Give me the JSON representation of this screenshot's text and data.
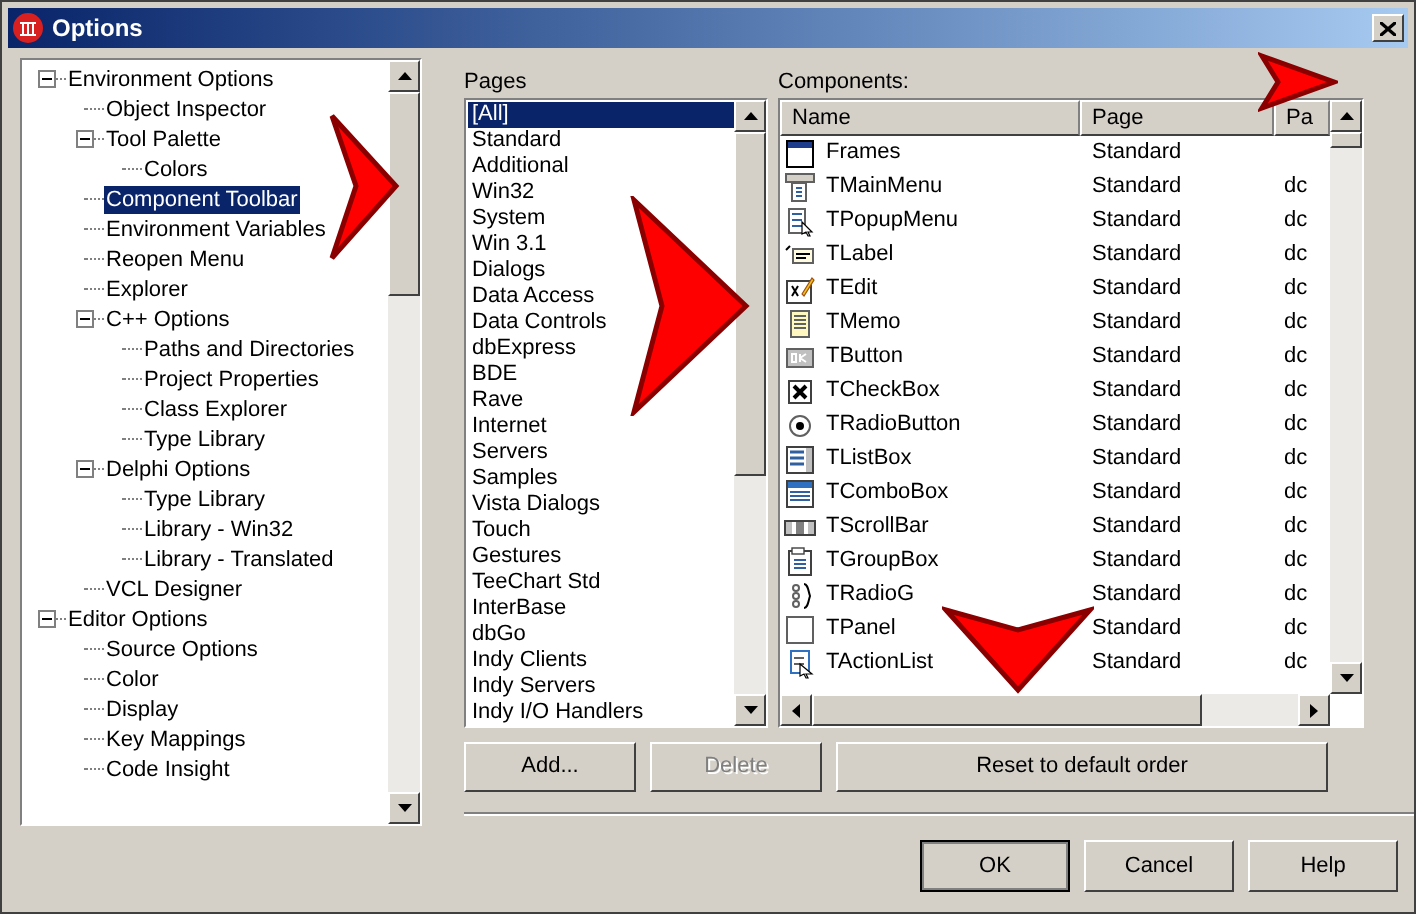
{
  "window": {
    "title": "Options"
  },
  "tree": [
    {
      "label": "Environment Options",
      "expanded": true,
      "selected": false,
      "children": [
        {
          "label": "Object Inspector",
          "selected": false
        },
        {
          "label": "Tool Palette",
          "expanded": true,
          "selected": false,
          "children": [
            {
              "label": "Colors",
              "selected": false
            }
          ]
        },
        {
          "label": "Component Toolbar",
          "selected": true
        },
        {
          "label": "Environment Variables",
          "selected": false
        },
        {
          "label": "Reopen Menu",
          "selected": false
        },
        {
          "label": "Explorer",
          "selected": false
        },
        {
          "label": "C++ Options",
          "expanded": true,
          "selected": false,
          "children": [
            {
              "label": "Paths and Directories",
              "selected": false
            },
            {
              "label": "Project Properties",
              "selected": false
            },
            {
              "label": "Class Explorer",
              "selected": false
            },
            {
              "label": "Type Library",
              "selected": false
            }
          ]
        },
        {
          "label": "Delphi Options",
          "expanded": true,
          "selected": false,
          "children": [
            {
              "label": "Type Library",
              "selected": false
            },
            {
              "label": "Library - Win32",
              "selected": false
            },
            {
              "label": "Library - Translated",
              "selected": false
            }
          ]
        },
        {
          "label": "VCL Designer",
          "selected": false
        }
      ]
    },
    {
      "label": "Editor Options",
      "expanded": true,
      "selected": false,
      "children": [
        {
          "label": "Source Options",
          "selected": false
        },
        {
          "label": "Color",
          "selected": false
        },
        {
          "label": "Display",
          "selected": false
        },
        {
          "label": "Key Mappings",
          "selected": false
        },
        {
          "label": "Code Insight",
          "selected": false
        }
      ]
    }
  ],
  "pages": {
    "label": "Pages",
    "items": [
      {
        "label": "[All]",
        "selected": true
      },
      {
        "label": "Standard",
        "selected": false
      },
      {
        "label": "Additional",
        "selected": false
      },
      {
        "label": "Win32",
        "selected": false
      },
      {
        "label": "System",
        "selected": false
      },
      {
        "label": "Win 3.1",
        "selected": false
      },
      {
        "label": "Dialogs",
        "selected": false
      },
      {
        "label": "Data Access",
        "selected": false
      },
      {
        "label": "Data Controls",
        "selected": false
      },
      {
        "label": "dbExpress",
        "selected": false
      },
      {
        "label": "BDE",
        "selected": false
      },
      {
        "label": "Rave",
        "selected": false
      },
      {
        "label": "Internet",
        "selected": false
      },
      {
        "label": "Servers",
        "selected": false
      },
      {
        "label": "Samples",
        "selected": false
      },
      {
        "label": "Vista Dialogs",
        "selected": false
      },
      {
        "label": "Touch",
        "selected": false
      },
      {
        "label": "Gestures",
        "selected": false
      },
      {
        "label": "TeeChart Std",
        "selected": false
      },
      {
        "label": "InterBase",
        "selected": false
      },
      {
        "label": "dbGo",
        "selected": false
      },
      {
        "label": "Indy Clients",
        "selected": false
      },
      {
        "label": "Indy Servers",
        "selected": false
      },
      {
        "label": "Indy I/O Handlers",
        "selected": false
      }
    ]
  },
  "components": {
    "label": "Components:",
    "columns": [
      "Name",
      "Page",
      "Pa"
    ],
    "rows": [
      {
        "name": "Frames",
        "page": "Standard"
      },
      {
        "name": "TMainMenu",
        "page": "Standard",
        "column_3": "dc"
      },
      {
        "name": "TPopupMenu",
        "page": "Standard",
        "column_3": "dc"
      },
      {
        "name": "TLabel",
        "page": "Standard",
        "column_3": "dc"
      },
      {
        "name": "TEdit",
        "page": "Standard",
        "column_3": "dc"
      },
      {
        "name": "TMemo",
        "page": "Standard",
        "column_3": "dc"
      },
      {
        "name": "TButton",
        "page": "Standard",
        "column_3": "dc"
      },
      {
        "name": "TCheckBox",
        "page": "Standard",
        "column_3": "dc"
      },
      {
        "name": "TRadioButton",
        "page": "Standard",
        "column_3": "dc"
      },
      {
        "name": "TListBox",
        "page": "Standard",
        "column_3": "dc"
      },
      {
        "name": "TComboBox",
        "page": "Standard",
        "column_3": "dc"
      },
      {
        "name": "TScrollBar",
        "page": "Standard",
        "column_3": "dc"
      },
      {
        "name": "TGroupBox",
        "page": "Standard",
        "column_3": "dc"
      },
      {
        "name": "TRadioG",
        "page": "Standard",
        "column_3": "dc"
      },
      {
        "name": "TPanel",
        "page": "Standard",
        "column_3": "dc"
      },
      {
        "name": "TActionList",
        "page": "Standard",
        "column_3": "dc"
      }
    ]
  },
  "list_buttons": [
    {
      "label": "Add...",
      "disabled": false
    },
    {
      "label": "Delete",
      "disabled": true
    },
    {
      "label": "Reset to default order",
      "disabled": false
    }
  ],
  "dialog_buttons": [
    {
      "label": "OK",
      "default": true
    },
    {
      "label": "Cancel",
      "default": false
    },
    {
      "label": "Help",
      "default": false
    }
  ]
}
